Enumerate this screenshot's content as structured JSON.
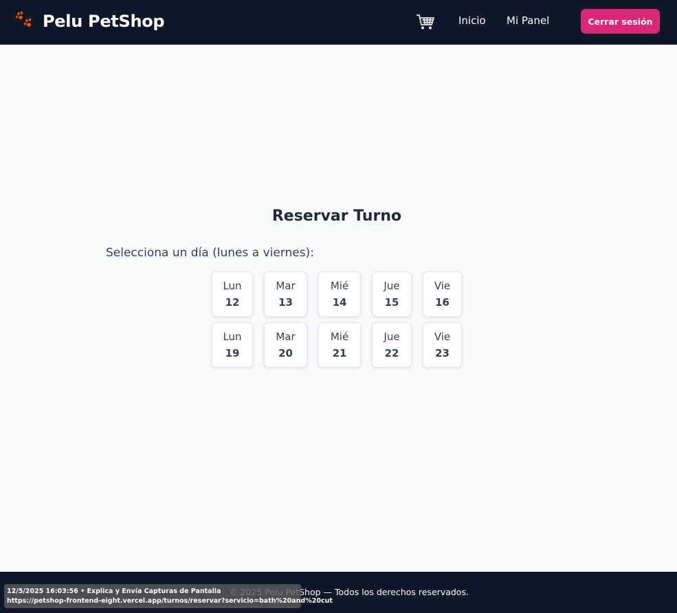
{
  "header": {
    "brand_name": "Pelu PetShop",
    "brand_icon": "paw-icon",
    "cart_icon": "cart-icon",
    "nav": {
      "inicio": "Inicio",
      "panel": "Mi Panel"
    },
    "logout_label": "Cerrar sesión"
  },
  "main": {
    "title": "Reservar Turno",
    "subtitle": "Selecciona un día (lunes a viernes):",
    "days": [
      {
        "name": "Lun",
        "num": "12"
      },
      {
        "name": "Mar",
        "num": "13"
      },
      {
        "name": "Mié",
        "num": "14"
      },
      {
        "name": "Jue",
        "num": "15"
      },
      {
        "name": "Vie",
        "num": "16"
      },
      {
        "name": "Lun",
        "num": "19"
      },
      {
        "name": "Mar",
        "num": "20"
      },
      {
        "name": "Mié",
        "num": "21"
      },
      {
        "name": "Jue",
        "num": "22"
      },
      {
        "name": "Vie",
        "num": "23"
      }
    ]
  },
  "footer": {
    "text": "© 2025 Pelu PetShop — Todos los derechos reservados."
  },
  "overlay": {
    "line1": "12/5/2025 16:03:56 • Explica y Envía Capturas de Pantalla",
    "line2": "https://petshop-frontend-eight.vercel.app/turnos/reservar?servicio=bath%20and%20cut"
  },
  "colors": {
    "navbar": "#0f172a",
    "accent": "#db2777",
    "background": "#f8fafc"
  }
}
